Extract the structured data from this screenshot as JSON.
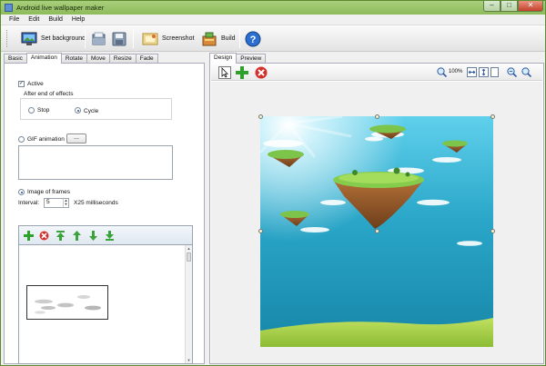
{
  "window": {
    "title": "Android live wallpaper maker"
  },
  "menu": [
    "File",
    "Edit",
    "Build",
    "Help"
  ],
  "toolbar": {
    "set_background": "Set background",
    "screenshot": "Screenshot",
    "build": "Build"
  },
  "left_tabs": [
    "Basic",
    "Animation",
    "Rotate",
    "Move",
    "Resize",
    "Fade"
  ],
  "left_active_tab": "Animation",
  "animation": {
    "active_label": "Active",
    "active_checked": true,
    "after_end_label": "After end of effects",
    "stop_label": "Stop",
    "cycle_label": "Cycle",
    "selected_end_mode": "Cycle",
    "gif_label": "GIF animation",
    "gif_browse": "...",
    "frames_label": "Image of frames",
    "selected_source": "Image of frames",
    "interval_label": "Interval:",
    "interval_value": "5",
    "interval_unit": "X25 milliseconds"
  },
  "right_tabs": [
    "Design",
    "Preview"
  ],
  "right_active_tab": "Design",
  "design": {
    "zoom": "100%"
  },
  "colors": {
    "titlebar": "#99c46a",
    "sky_top": "#4fc0e0",
    "sky_bottom": "#1d8fb1",
    "grass": "#a9d247"
  },
  "icons": {
    "set_background": "monitor-background-icon",
    "open": "folder-open-icon",
    "save": "floppy-save-icon",
    "screenshot": "screenshot-icon",
    "build": "build-package-icon",
    "help": "help-icon"
  }
}
